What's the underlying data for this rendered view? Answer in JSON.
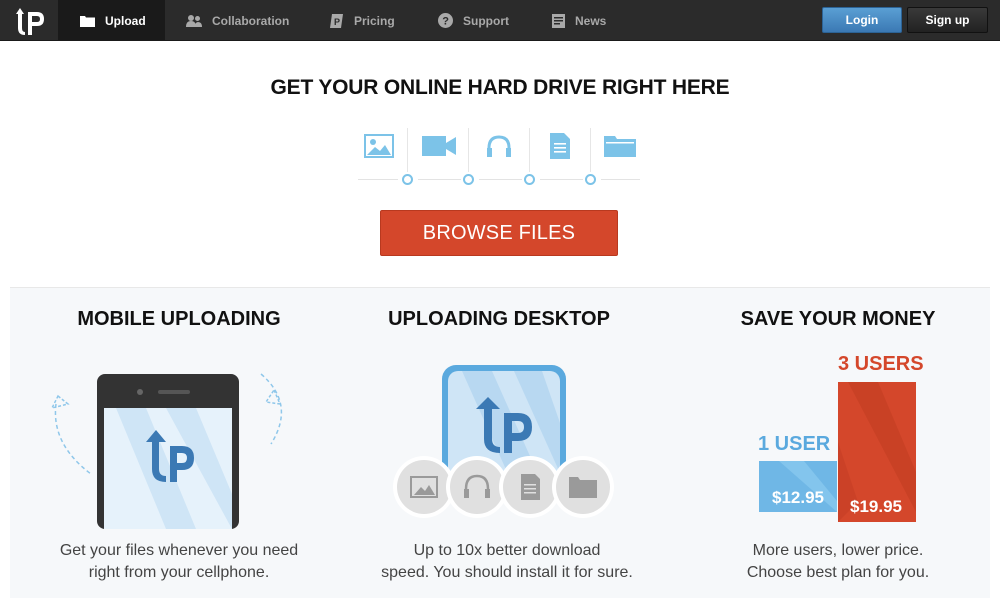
{
  "navbar": {
    "logo_text": "UP",
    "items": [
      {
        "label": "Upload",
        "icon": "folder-icon",
        "active": true
      },
      {
        "label": "Collaboration",
        "icon": "users-icon",
        "active": false
      },
      {
        "label": "Pricing",
        "icon": "price-tag-icon",
        "active": false
      },
      {
        "label": "Support",
        "icon": "question-icon",
        "active": false
      },
      {
        "label": "News",
        "icon": "document-icon",
        "active": false
      }
    ],
    "login_label": "Login",
    "signup_label": "Sign up"
  },
  "hero": {
    "title": "GET YOUR ONLINE HARD DRIVE RIGHT HERE",
    "file_types": [
      "image-icon",
      "video-icon",
      "audio-icon",
      "document-icon",
      "folder-icon"
    ],
    "browse_label": "BROWSE FILES"
  },
  "features": [
    {
      "title": "MOBILE UPLOADING",
      "desc_line1": "Get your files whenever you need",
      "desc_line2": "right from your cellphone."
    },
    {
      "title": "UPLOADING DESKTOP",
      "desc_line1": "Up to 10x better download",
      "desc_line2": "speed. You should install it for sure."
    },
    {
      "title": "SAVE YOUR MONEY",
      "desc_line1": "More users, lower price.",
      "desc_line2": "Choose best plan for you."
    }
  ],
  "pricing": {
    "plan_1_label": "1 USER",
    "plan_1_price": "$12.95",
    "plan_3_label": "3 USERS",
    "plan_3_price": "$19.95"
  },
  "colors": {
    "accent_red": "#d4472b",
    "accent_blue": "#5aa9de",
    "navbar_bg": "#2b2b2b"
  }
}
